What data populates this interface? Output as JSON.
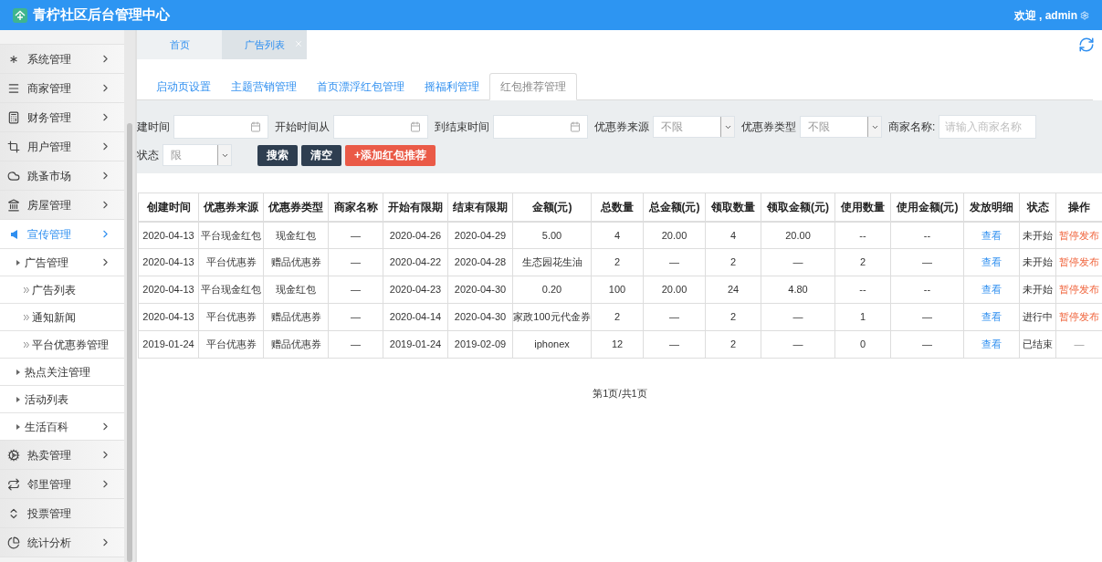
{
  "header": {
    "title": "青柠社区后台管理中心",
    "greeting": "欢迎 , admin"
  },
  "sidebar": {
    "items": [
      {
        "label": "系统管理",
        "selected": false,
        "expandable": true
      },
      {
        "label": "商家管理",
        "selected": false,
        "expandable": true
      },
      {
        "label": "财务管理",
        "selected": false,
        "expandable": true
      },
      {
        "label": "用户管理",
        "selected": false,
        "expandable": true
      },
      {
        "label": "跳蚤市场",
        "selected": false,
        "expandable": true
      },
      {
        "label": "房屋管理",
        "selected": false,
        "expandable": true
      },
      {
        "label": "宣传管理",
        "selected": true,
        "expandable": true,
        "children": [
          {
            "label": "广告管理",
            "selected": false,
            "expandable": true,
            "children": [
              {
                "label": "广告列表",
                "selected": false
              },
              {
                "label": "通知新闻",
                "selected": false
              },
              {
                "label": "平台优惠券管理",
                "selected": false
              }
            ]
          },
          {
            "label": "热点关注管理",
            "selected": false,
            "expandable": false
          },
          {
            "label": "活动列表",
            "selected": false,
            "expandable": false
          },
          {
            "label": "生活百科",
            "selected": false,
            "expandable": true
          }
        ]
      },
      {
        "label": "热卖管理",
        "selected": false,
        "expandable": true
      },
      {
        "label": "邻里管理",
        "selected": false,
        "expandable": true
      },
      {
        "label": "投票管理",
        "selected": false,
        "expandable": false
      },
      {
        "label": "统计分析",
        "selected": false,
        "expandable": true
      }
    ]
  },
  "page_tabs": [
    {
      "label": "首页",
      "selected": false,
      "closable": false
    },
    {
      "label": "广告列表",
      "selected": true,
      "closable": true
    }
  ],
  "sub_tabs": [
    {
      "label": "启动页设置",
      "selected": false
    },
    {
      "label": "主题营销管理",
      "selected": false
    },
    {
      "label": "首页漂浮红包管理",
      "selected": false
    },
    {
      "label": "摇福利管理",
      "selected": false
    },
    {
      "label": "红包推荐管理",
      "selected": true
    }
  ],
  "filters": [
    {
      "label": "建时间",
      "kind": "date"
    },
    {
      "label": "开始时间从",
      "kind": "date"
    },
    {
      "label": "到结束时间",
      "kind": "date"
    },
    {
      "label": "优惠券来源",
      "kind": "select",
      "value": "不限"
    },
    {
      "label": "优惠券类型",
      "kind": "select",
      "value": "不限"
    },
    {
      "label": "商家名称:",
      "kind": "text",
      "placeholder": "请输入商家名称"
    },
    {
      "label": "状态",
      "kind": "select",
      "value": "限"
    }
  ],
  "buttons": [
    {
      "label": "搜索",
      "kind": "dark"
    },
    {
      "label": "清空",
      "kind": "dark"
    },
    {
      "label": "+添加红包推荐",
      "kind": "danger"
    }
  ],
  "table": {
    "columns": [
      {
        "label": "创建时间",
        "kind": "text"
      },
      {
        "label": "优惠券来源",
        "kind": "text"
      },
      {
        "label": "优惠券类型",
        "kind": "text"
      },
      {
        "label": "商家名称",
        "kind": "text"
      },
      {
        "label": "开始有限期",
        "kind": "text"
      },
      {
        "label": "结束有限期",
        "kind": "text"
      },
      {
        "label": "金额(元)",
        "kind": "text"
      },
      {
        "label": "总数量",
        "kind": "text"
      },
      {
        "label": "总金额(元)",
        "kind": "text"
      },
      {
        "label": "领取数量",
        "kind": "text"
      },
      {
        "label": "领取金额(元)",
        "kind": "text"
      },
      {
        "label": "使用数量",
        "kind": "text"
      },
      {
        "label": "使用金额(元)",
        "kind": "text"
      },
      {
        "label": "发放明细",
        "kind": "link"
      },
      {
        "label": "状态",
        "kind": "text"
      },
      {
        "label": "操作",
        "kind": "action"
      }
    ],
    "rows": [
      {
        "cells": [
          "2020-04-13",
          "平台现金红包",
          "现金红包",
          "—",
          "2020-04-26",
          "2020-04-29",
          "5.00",
          "4",
          "20.00",
          "4",
          "20.00",
          "--",
          "--",
          "查看",
          "未开始",
          "暂停发布"
        ],
        "action_enabled": true
      },
      {
        "cells": [
          "2020-04-13",
          "平台优惠券",
          "赠品优惠券",
          "—",
          "2020-04-22",
          "2020-04-28",
          "生态园花生油",
          "2",
          "—",
          "2",
          "—",
          "2",
          "—",
          "查看",
          "未开始",
          "暂停发布"
        ],
        "action_enabled": true
      },
      {
        "cells": [
          "2020-04-13",
          "平台现金红包",
          "现金红包",
          "—",
          "2020-04-23",
          "2020-04-30",
          "0.20",
          "100",
          "20.00",
          "24",
          "4.80",
          "--",
          "--",
          "查看",
          "未开始",
          "暂停发布"
        ],
        "action_enabled": true
      },
      {
        "cells": [
          "2020-04-13",
          "平台优惠券",
          "赠品优惠券",
          "—",
          "2020-04-14",
          "2020-04-30",
          "家政100元代金券",
          "2",
          "—",
          "2",
          "—",
          "1",
          "—",
          "查看",
          "进行中",
          "暂停发布"
        ],
        "action_enabled": true
      },
      {
        "cells": [
          "2019-01-24",
          "平台优惠券",
          "赠品优惠券",
          "—",
          "2019-01-24",
          "2019-02-09",
          "iphonex",
          "12",
          "—",
          "2",
          "—",
          "0",
          "—",
          "查看",
          "已结束",
          "—"
        ],
        "action_enabled": false
      }
    ]
  },
  "pagination": "第1页/共1页"
}
